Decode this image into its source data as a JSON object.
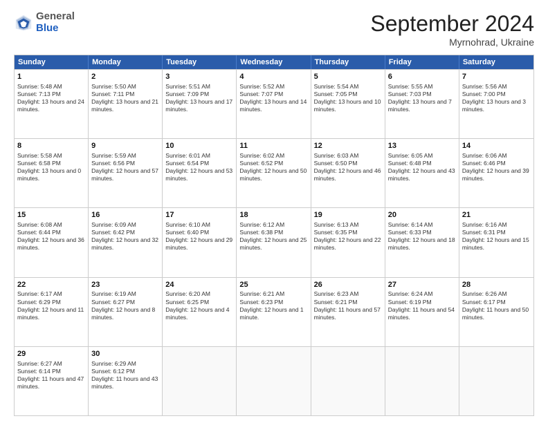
{
  "logo": {
    "general": "General",
    "blue": "Blue"
  },
  "header": {
    "month": "September 2024",
    "location": "Myrnohrad, Ukraine"
  },
  "days": [
    "Sunday",
    "Monday",
    "Tuesday",
    "Wednesday",
    "Thursday",
    "Friday",
    "Saturday"
  ],
  "weeks": [
    [
      {
        "day": "1",
        "sunrise": "5:48 AM",
        "sunset": "7:13 PM",
        "daylight": "13 hours and 24 minutes."
      },
      {
        "day": "2",
        "sunrise": "5:50 AM",
        "sunset": "7:11 PM",
        "daylight": "13 hours and 21 minutes."
      },
      {
        "day": "3",
        "sunrise": "5:51 AM",
        "sunset": "7:09 PM",
        "daylight": "13 hours and 17 minutes."
      },
      {
        "day": "4",
        "sunrise": "5:52 AM",
        "sunset": "7:07 PM",
        "daylight": "13 hours and 14 minutes."
      },
      {
        "day": "5",
        "sunrise": "5:54 AM",
        "sunset": "7:05 PM",
        "daylight": "13 hours and 10 minutes."
      },
      {
        "day": "6",
        "sunrise": "5:55 AM",
        "sunset": "7:03 PM",
        "daylight": "13 hours and 7 minutes."
      },
      {
        "day": "7",
        "sunrise": "5:56 AM",
        "sunset": "7:00 PM",
        "daylight": "13 hours and 3 minutes."
      }
    ],
    [
      {
        "day": "8",
        "sunrise": "5:58 AM",
        "sunset": "6:58 PM",
        "daylight": "13 hours and 0 minutes."
      },
      {
        "day": "9",
        "sunrise": "5:59 AM",
        "sunset": "6:56 PM",
        "daylight": "12 hours and 57 minutes."
      },
      {
        "day": "10",
        "sunrise": "6:01 AM",
        "sunset": "6:54 PM",
        "daylight": "12 hours and 53 minutes."
      },
      {
        "day": "11",
        "sunrise": "6:02 AM",
        "sunset": "6:52 PM",
        "daylight": "12 hours and 50 minutes."
      },
      {
        "day": "12",
        "sunrise": "6:03 AM",
        "sunset": "6:50 PM",
        "daylight": "12 hours and 46 minutes."
      },
      {
        "day": "13",
        "sunrise": "6:05 AM",
        "sunset": "6:48 PM",
        "daylight": "12 hours and 43 minutes."
      },
      {
        "day": "14",
        "sunrise": "6:06 AM",
        "sunset": "6:46 PM",
        "daylight": "12 hours and 39 minutes."
      }
    ],
    [
      {
        "day": "15",
        "sunrise": "6:08 AM",
        "sunset": "6:44 PM",
        "daylight": "12 hours and 36 minutes."
      },
      {
        "day": "16",
        "sunrise": "6:09 AM",
        "sunset": "6:42 PM",
        "daylight": "12 hours and 32 minutes."
      },
      {
        "day": "17",
        "sunrise": "6:10 AM",
        "sunset": "6:40 PM",
        "daylight": "12 hours and 29 minutes."
      },
      {
        "day": "18",
        "sunrise": "6:12 AM",
        "sunset": "6:38 PM",
        "daylight": "12 hours and 25 minutes."
      },
      {
        "day": "19",
        "sunrise": "6:13 AM",
        "sunset": "6:35 PM",
        "daylight": "12 hours and 22 minutes."
      },
      {
        "day": "20",
        "sunrise": "6:14 AM",
        "sunset": "6:33 PM",
        "daylight": "12 hours and 18 minutes."
      },
      {
        "day": "21",
        "sunrise": "6:16 AM",
        "sunset": "6:31 PM",
        "daylight": "12 hours and 15 minutes."
      }
    ],
    [
      {
        "day": "22",
        "sunrise": "6:17 AM",
        "sunset": "6:29 PM",
        "daylight": "12 hours and 11 minutes."
      },
      {
        "day": "23",
        "sunrise": "6:19 AM",
        "sunset": "6:27 PM",
        "daylight": "12 hours and 8 minutes."
      },
      {
        "day": "24",
        "sunrise": "6:20 AM",
        "sunset": "6:25 PM",
        "daylight": "12 hours and 4 minutes."
      },
      {
        "day": "25",
        "sunrise": "6:21 AM",
        "sunset": "6:23 PM",
        "daylight": "12 hours and 1 minute."
      },
      {
        "day": "26",
        "sunrise": "6:23 AM",
        "sunset": "6:21 PM",
        "daylight": "11 hours and 57 minutes."
      },
      {
        "day": "27",
        "sunrise": "6:24 AM",
        "sunset": "6:19 PM",
        "daylight": "11 hours and 54 minutes."
      },
      {
        "day": "28",
        "sunrise": "6:26 AM",
        "sunset": "6:17 PM",
        "daylight": "11 hours and 50 minutes."
      }
    ],
    [
      {
        "day": "29",
        "sunrise": "6:27 AM",
        "sunset": "6:14 PM",
        "daylight": "11 hours and 47 minutes."
      },
      {
        "day": "30",
        "sunrise": "6:29 AM",
        "sunset": "6:12 PM",
        "daylight": "11 hours and 43 minutes."
      },
      null,
      null,
      null,
      null,
      null
    ]
  ]
}
